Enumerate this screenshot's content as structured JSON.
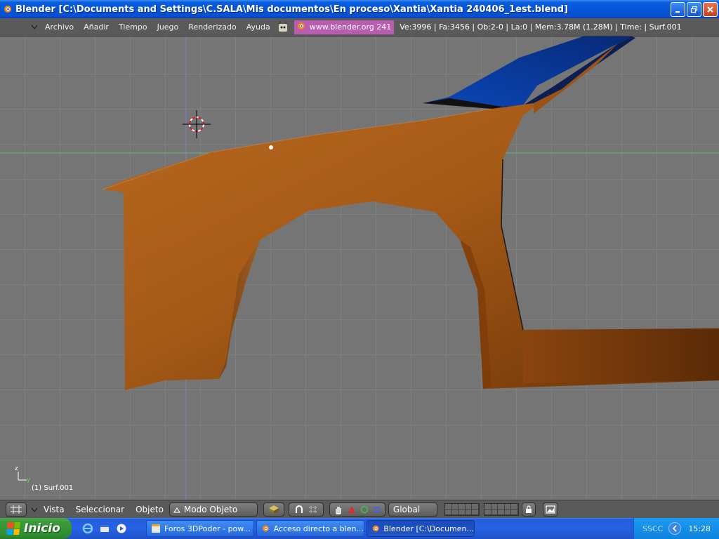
{
  "window": {
    "title": "Blender [C:\\Documents and Settings\\C.SALA\\Mis documentos\\En proceso\\Xantia\\Xantia 240406_1est.blend]",
    "icon": "blender-icon",
    "buttons": [
      "minimize-icon",
      "restore-icon",
      "close-icon"
    ]
  },
  "info_header": {
    "menus": [
      "Archivo",
      "Añadir",
      "Tiempo",
      "Juego",
      "Renderizado",
      "Ayuda"
    ],
    "url": "www.blender.org 241",
    "stats": "Ve:3996 | Fa:3456 | Ob:2-0 | La:0  | Mem:3.78M (1.28M)  | Time:  | Surf.001"
  },
  "viewport": {
    "background": "#757575",
    "grid_color": "#8a8a8a",
    "x_axis_color": "#6bb36b",
    "y_axis_color": "#7a7ad0",
    "mesh_color": "#a85b1a",
    "blue_part_color": "#0a3a9a",
    "object_label": "(1) Surf.001",
    "axis_z": "z",
    "axis_y": "y"
  },
  "view_header": {
    "menus": [
      "Vista",
      "Seleccionar",
      "Objeto"
    ],
    "mode": "Modo Objeto",
    "orientation": "Global"
  },
  "taskbar": {
    "start_label": "Inicio",
    "tasks": [
      {
        "label": "Foros 3DPoder - pow...",
        "icon": "browser-icon",
        "active": false
      },
      {
        "label": "Acceso directo a blen...",
        "icon": "blender-icon",
        "active": false
      },
      {
        "label": "Blender [C:\\Documen...",
        "icon": "blender-icon",
        "active": true
      }
    ],
    "tray_lang": "SSCC",
    "clock": "15:28"
  }
}
